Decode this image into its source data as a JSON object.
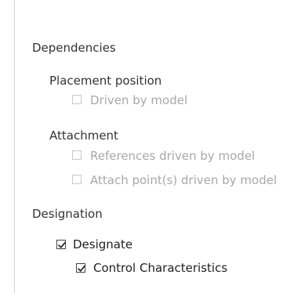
{
  "sections": {
    "dependencies": {
      "title": "Dependencies",
      "placement_position": {
        "title": "Placement position",
        "options": [
          {
            "label": "Driven by model",
            "checked": false,
            "enabled": false
          }
        ]
      },
      "attachment": {
        "title": "Attachment",
        "options": [
          {
            "label": "References driven by model",
            "checked": false,
            "enabled": false
          },
          {
            "label": "Attach point(s) driven by model",
            "checked": false,
            "enabled": false
          }
        ]
      }
    },
    "designation": {
      "title": "Designation",
      "designate": {
        "label": "Designate",
        "checked": true,
        "enabled": true
      },
      "control_characteristics": {
        "label": "Control Characteristics",
        "checked": true,
        "enabled": true
      }
    }
  },
  "colors": {
    "section_text": "#333333",
    "enabled_text": "#1f1f1f",
    "disabled_text": "#a8a8a8",
    "check_mark": "#1f1f1f"
  },
  "icons": {
    "checked": "checkmark-icon",
    "unchecked": "empty-checkbox"
  }
}
